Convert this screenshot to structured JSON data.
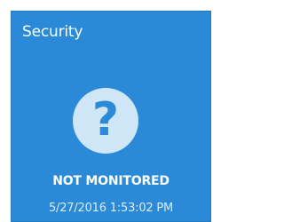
{
  "tile": {
    "title": "Security",
    "icon": "question-mark-icon",
    "icon_glyph": "?",
    "status": "NOT MONITORED",
    "timestamp": "5/27/2016 1:53:02 PM",
    "colors": {
      "background": "#2b8ad8",
      "icon_circle": "#cfe6f7",
      "text": "#ffffff"
    }
  }
}
